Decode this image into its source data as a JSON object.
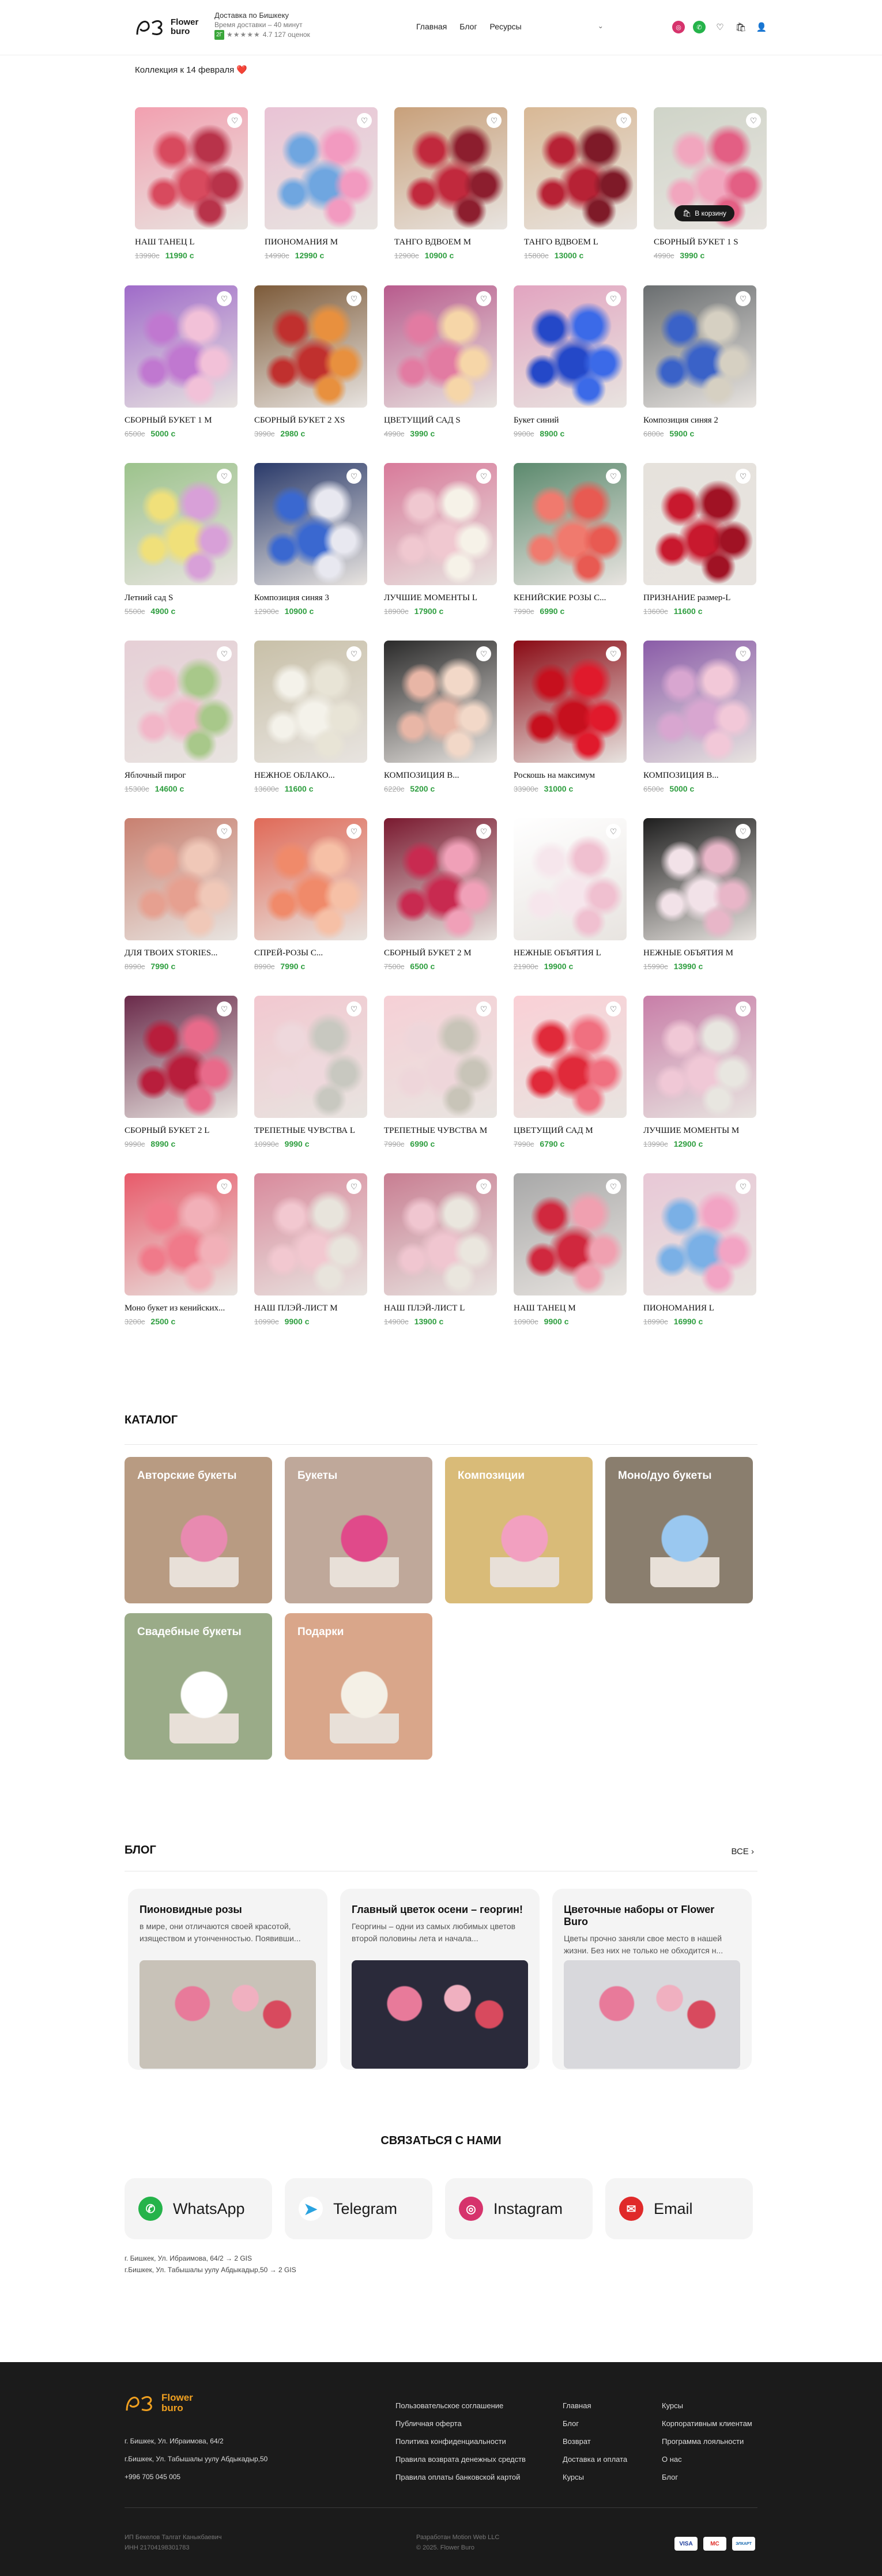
{
  "header": {
    "logo_text_1": "Flower",
    "logo_text_2": "buro",
    "delivery_title": "Доставка по Бишкеку",
    "delivery_time": "Время доставки – 40 минут",
    "rating_badge": "2Г",
    "rating_stars": "★★★★★",
    "rating_text": "4.7 127 оценок",
    "nav": [
      "Главная",
      "Блог",
      "Ресурсы"
    ],
    "nav_dropdown": "⌄",
    "icons": [
      "instagram-icon",
      "whatsapp-icon",
      "heart-icon",
      "cart-icon",
      "user-icon"
    ]
  },
  "promo": "Коллекция к 14 февраля ❤️",
  "products": [
    {
      "name": "НАШ ТАНЕЦ L",
      "old": "13990с",
      "new": "11990 с",
      "colors": [
        "#d84a5e",
        "#b8334a",
        "#f2a0b0"
      ]
    },
    {
      "name": "ПИОНОМАНИЯ M",
      "old": "14990с",
      "new": "12990 с",
      "colors": [
        "#6fa6e0",
        "#f29ac0",
        "#e9c3d5"
      ]
    },
    {
      "name": "ТАНГО ВДВОЕМ M",
      "old": "12900с",
      "new": "10900 с",
      "colors": [
        "#c1293d",
        "#8c1e2e",
        "#c8a07a"
      ]
    },
    {
      "name": "ТАНГО ВДВОЕМ L",
      "old": "15800с",
      "new": "13000 с",
      "colors": [
        "#b72235",
        "#7e1a28",
        "#d8b895"
      ]
    },
    {
      "name": "СБОРНЫЙ БУКЕТ 1 S",
      "old": "4990с",
      "new": "3990 с",
      "colors": [
        "#f1a6be",
        "#e35f84",
        "#cfd4c8"
      ],
      "cart": "В корзину"
    },
    {
      "name": "СБОРНЫЙ БУКЕТ 1 M",
      "old": "6500с",
      "new": "5000 с",
      "colors": [
        "#c078d0",
        "#f2c1d8",
        "#9f6bc9"
      ]
    },
    {
      "name": "СБОРНЫЙ БУКЕТ 2 XS",
      "old": "3990с",
      "new": "2980 с",
      "colors": [
        "#c0302e",
        "#e8903e",
        "#7d5b3a"
      ]
    },
    {
      "name": "ЦВЕТУЩИЙ САД S",
      "old": "4990с",
      "new": "3990 с",
      "colors": [
        "#e27ba2",
        "#f6d6a8",
        "#b85b8d"
      ]
    },
    {
      "name": "Букет синий",
      "old": "9900с",
      "new": "8900 с",
      "colors": [
        "#2448c8",
        "#3b6ae8",
        "#e2a4c0"
      ]
    },
    {
      "name": "Композиция синяя 2",
      "old": "6800с",
      "new": "5900 с",
      "colors": [
        "#3a62c8",
        "#d6d0c2",
        "#6a6e70"
      ]
    },
    {
      "name": "Летний сад S",
      "old": "5500с",
      "new": "4900 с",
      "colors": [
        "#f0e07a",
        "#d8a0d8",
        "#9cc38c"
      ]
    },
    {
      "name": "Композиция синяя 3",
      "old": "12900с",
      "new": "10900 с",
      "colors": [
        "#3a68d0",
        "#e8e8f0",
        "#2a3a6a"
      ]
    },
    {
      "name": "ЛУЧШИЕ МОМЕНТЫ L",
      "old": "18900с",
      "new": "17900 с",
      "colors": [
        "#f0c8d0",
        "#f6f2e8",
        "#d87a9a"
      ]
    },
    {
      "name": "КЕНИЙСКИЕ РОЗЫ С...",
      "old": "7990с",
      "new": "6990 с",
      "colors": [
        "#f07a6e",
        "#e85a52",
        "#5c8a6e"
      ]
    },
    {
      "name": "ПРИЗНАНИЕ размер-L",
      "old": "13600с",
      "new": "11600 с",
      "colors": [
        "#c8192e",
        "#a01224",
        "#e6e2dc"
      ]
    },
    {
      "name": "Яблочный пирог",
      "old": "15300с",
      "new": "14600 с",
      "colors": [
        "#f2b6c8",
        "#a8c88a",
        "#e6cfd6"
      ]
    },
    {
      "name": "НЕЖНОЕ ОБЛАКО...",
      "old": "13600с",
      "new": "11600 с",
      "colors": [
        "#f4f2ea",
        "#e8e4d6",
        "#c8c0a8"
      ]
    },
    {
      "name": "КОМПОЗИЦИЯ В...",
      "old": "6220с",
      "new": "5200 с",
      "colors": [
        "#e8b6a6",
        "#f2d8c8",
        "#2a2a2a"
      ]
    },
    {
      "name": "Роскошь на максимум",
      "old": "33900с",
      "new": "31000 с",
      "colors": [
        "#c6101e",
        "#e01a2c",
        "#8a0a14"
      ]
    },
    {
      "name": "КОМПОЗИЦИЯ В...",
      "old": "6500с",
      "new": "5000 с",
      "colors": [
        "#d8a6d0",
        "#f2c8d8",
        "#8a5ca8"
      ]
    },
    {
      "name": "ДЛЯ ТВОИХ STORIES...",
      "old": "8990с",
      "new": "7990 с",
      "colors": [
        "#e6a090",
        "#f0c8b8",
        "#c88070"
      ]
    },
    {
      "name": "СПРЕЙ-РОЗЫ С...",
      "old": "8990с",
      "new": "7990 с",
      "colors": [
        "#f08a6a",
        "#f6c0a6",
        "#e06a58"
      ]
    },
    {
      "name": "СБОРНЫЙ БУКЕТ 2 M",
      "old": "7500с",
      "new": "6500 с",
      "colors": [
        "#c82a50",
        "#f0a0b8",
        "#7a1a30"
      ]
    },
    {
      "name": "НЕЖНЫЕ ОБЪЯТИЯ L",
      "old": "21900с",
      "new": "19900 с",
      "colors": [
        "#f6e6ec",
        "#f0c0d0",
        "#ffffff"
      ]
    },
    {
      "name": "НЕЖНЫЕ ОБЪЯТИЯ M",
      "old": "15990с",
      "new": "13990 с",
      "colors": [
        "#f2e2e8",
        "#e8b6c8",
        "#1e1e1e"
      ]
    },
    {
      "name": "СБОРНЫЙ БУКЕТ 2 L",
      "old": "9990с",
      "new": "8990 с",
      "colors": [
        "#b81e3c",
        "#e86a8a",
        "#6a2a4a"
      ]
    },
    {
      "name": "ТРЕПЕТНЫЕ ЧУВСТВА L",
      "old": "10990с",
      "new": "9990 с",
      "colors": [
        "#eed8dc",
        "#c8c8c0",
        "#f2c8d0"
      ]
    },
    {
      "name": "ТРЕПЕТНЫЕ ЧУВСТВА M",
      "old": "7990с",
      "new": "6990 с",
      "colors": [
        "#eed6da",
        "#c8c4b8",
        "#f6d0d6"
      ]
    },
    {
      "name": "ЦВЕТУЩИЙ САД M",
      "old": "7990с",
      "new": "6790 с",
      "colors": [
        "#e02a3a",
        "#f07080",
        "#fad0d6"
      ]
    },
    {
      "name": "ЛУЧШИЕ МОМЕНТЫ M",
      "old": "13990с",
      "new": "12900 с",
      "colors": [
        "#f0c8d6",
        "#e8e6e0",
        "#c87ea8"
      ]
    },
    {
      "name": "Моно букет из кенийских...",
      "old": "3200с",
      "new": "2500 с",
      "colors": [
        "#f07a8a",
        "#f2b0b8",
        "#e85a6a"
      ]
    },
    {
      "name": "НАШ ПЛЭЙ-ЛИСТ M",
      "old": "10990с",
      "new": "9900 с",
      "colors": [
        "#f2c8d0",
        "#e8e4dc",
        "#d88a9c"
      ]
    },
    {
      "name": "НАШ ПЛЭЙ-ЛИСТ L",
      "old": "14900с",
      "new": "13900 с",
      "colors": [
        "#f0c6d0",
        "#eae6de",
        "#c87e92"
      ]
    },
    {
      "name": "НАШ ТАНЕЦ M",
      "old": "10900с",
      "new": "9900 с",
      "colors": [
        "#d0283e",
        "#f0a0b0",
        "#a8a8a8"
      ]
    },
    {
      "name": "ПИОНОМАНИЯ L",
      "old": "18990с",
      "new": "16990 с",
      "colors": [
        "#7ab0e6",
        "#f2a4c4",
        "#e8c8d6"
      ]
    }
  ],
  "catalog": {
    "title": "КАТАЛОГ",
    "items": [
      {
        "label": "Авторские букеты",
        "bg": "#b89b82",
        "flower": "#e88ab0"
      },
      {
        "label": "Букеты",
        "bg": "#bfa89a",
        "flower": "#e04a8a"
      },
      {
        "label": "Композиции",
        "bg": "#d9bb78",
        "flower": "#f2a0c0"
      },
      {
        "label": "Моно/дуо букеты",
        "bg": "#8a7e6e",
        "flower": "#9ac8f0"
      },
      {
        "label": "Свадебные букеты",
        "bg": "#9aab88",
        "flower": "#ffffff"
      },
      {
        "label": "Подарки",
        "bg": "#d9a68a",
        "flower": "#f4f0e6"
      }
    ]
  },
  "blog": {
    "title": "БЛОГ",
    "all_label": "ВСЕ",
    "posts": [
      {
        "title": "Пионовидные розы",
        "text": "в мире, они отличаются своей красотой, изяществом и утонченностью. Появивши...",
        "bg": "#c8c2b8"
      },
      {
        "title": "Главный цветок осени – георгин!",
        "text": "Георгины – одни из самых любимых цветов второй половины лета и начала...",
        "bg": "#2a2a3a"
      },
      {
        "title": "Цветочные наборы от Flower Buro",
        "text": "Цветы прочно заняли свое место в нашей жизни. Без них не только не обходится н...",
        "bg": "#d8d8dc"
      }
    ]
  },
  "contact": {
    "title": "СВЯЗАТЬСЯ С НАМИ",
    "buttons": [
      {
        "label": "WhatsApp",
        "color": "#25b34a",
        "glyph": "✆"
      },
      {
        "label": "Telegram",
        "color": "#ffffff",
        "glyph": "➤"
      },
      {
        "label": "Instagram",
        "color": "#d6336c",
        "glyph": "◎"
      },
      {
        "label": "Email",
        "color": "#e02a2a",
        "glyph": "✉"
      }
    ],
    "addresses": [
      "г. Бишкек, Ул. Ибраимова, 64/2 → 2 GIS",
      "г.Бишкек, Ул. Табышалы уулу Абдыкадыр,50 → 2 GIS"
    ]
  },
  "footer": {
    "logo_1": "Flower",
    "logo_2": "buro",
    "address_1": "г. Бишкек, Ул. Ибраимова, 64/2",
    "address_2": "г.Бишкек, Ул. Табышалы уулу Абдыкадыр,50",
    "phone": "+996 705 045 005",
    "col1": [
      "Пользовательское соглашение",
      "Публичная оферта",
      "Политика конфиденциальности",
      "Правила возврата денежных средств",
      "Правила оплаты банковской картой"
    ],
    "col2": [
      "Главная",
      "Блог",
      "Возврат",
      "Доставка и оплата",
      "Курсы"
    ],
    "col3": [
      "Курсы",
      "Корпоративным клиентам",
      "Программа лояльности",
      "О нас",
      "Блог"
    ],
    "legal_1": "ИП Бекелов Талгат Каныкбаевич",
    "legal_2": "ИНН 21704198301783",
    "dev": "Разработан Motion Web LLC",
    "copyright": "© 2025. Flower Buro",
    "payments": [
      "VISA",
      "MC",
      "ЭЛКАРТ"
    ]
  }
}
